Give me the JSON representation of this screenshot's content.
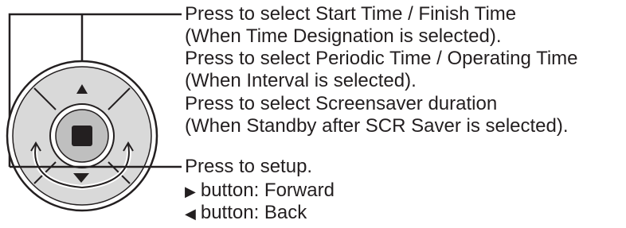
{
  "colors": {
    "ink": "#231f20",
    "pad_fill": "#d9d9d9",
    "center_fill": "#bfbfbf",
    "background": "#ffffff"
  },
  "icons": {
    "pad": "directional-pad-icon",
    "center": "stop-square-icon",
    "up_arrow": "triangle-up-icon",
    "down_arrow": "triangle-down-icon",
    "right_glyph": "▶",
    "left_glyph": "◀"
  },
  "annotations": {
    "line1": "Press to select Start Time / Finish Time",
    "line2": "(When Time Designation is selected).",
    "line3": "Press to select Periodic Time / Operating Time",
    "line4": "(When Interval is selected).",
    "line5": "Press to select Screensaver duration",
    "line6": "(When Standby after SCR Saver is selected).",
    "line7": "Press to setup.",
    "forward": "button: Forward",
    "back": "button: Back"
  }
}
